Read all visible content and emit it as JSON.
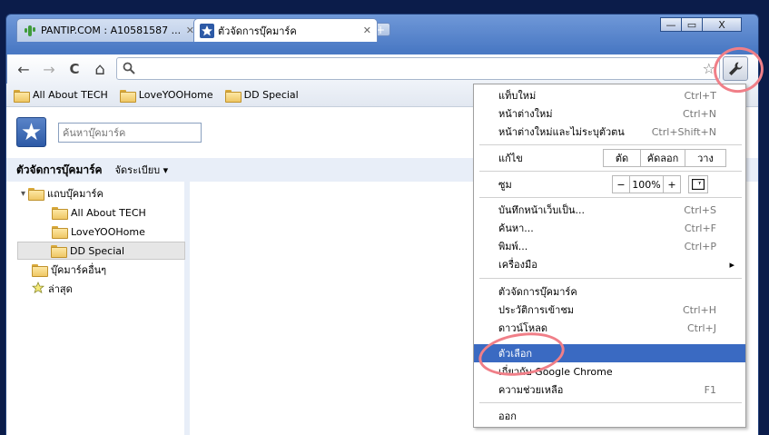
{
  "window": {
    "controls": {
      "minimize": "—",
      "maximize": "▭",
      "close": "X"
    }
  },
  "tabs": [
    {
      "title": "PANTIP.COM : A10581587 ...",
      "close": "✕"
    },
    {
      "title": "ตัวจัดการบุ๊คมาร์ค",
      "close": "✕"
    }
  ],
  "new_tab": "+",
  "toolbar": {
    "back": "←",
    "forward": "→",
    "reload": "C",
    "home": "⌂",
    "omnibox_value": "",
    "star": "☆"
  },
  "bookmarks_bar": [
    "All About TECH",
    "LoveYOOHome",
    "DD Special"
  ],
  "bookmark_manager": {
    "search_placeholder": "ค้นหาบุ๊คมาร์ค",
    "title": "ตัวจัดการบุ๊คมาร์ค",
    "organize": "จัดระเบียบ ▾",
    "tree": [
      {
        "label": "แถบบุ๊คมาร์ค",
        "expander": "▾"
      },
      {
        "label": "All About TECH"
      },
      {
        "label": "LoveYOOHome"
      },
      {
        "label": "DD Special"
      },
      {
        "label": "บุ๊คมาร์คอื่นๆ"
      },
      {
        "label": "ล่าสุด"
      }
    ]
  },
  "menu": {
    "new_tab": {
      "label": "แท็บใหม่",
      "shortcut": "Ctrl+T"
    },
    "new_window": {
      "label": "หน้าต่างใหม่",
      "shortcut": "Ctrl+N"
    },
    "incognito": {
      "label": "หน้าต่างใหม่และไม่ระบุตัวตน",
      "shortcut": "Ctrl+Shift+N"
    },
    "edit": {
      "label": "แก้ไข",
      "cut": "ตัด",
      "copy": "คัดลอก",
      "paste": "วาง"
    },
    "zoom": {
      "label": "ซูม",
      "minus": "−",
      "value": "100%",
      "plus": "+"
    },
    "save_page": {
      "label": "บันทึกหน้าเว็บเป็น...",
      "shortcut": "Ctrl+S"
    },
    "find": {
      "label": "ค้นหา...",
      "shortcut": "Ctrl+F"
    },
    "print": {
      "label": "พิมพ์...",
      "shortcut": "Ctrl+P"
    },
    "tools": {
      "label": "เครื่องมือ",
      "arrow": "▸"
    },
    "bookmark_manager": {
      "label": "ตัวจัดการบุ๊คมาร์ค"
    },
    "history": {
      "label": "ประวัติการเข้าชม",
      "shortcut": "Ctrl+H"
    },
    "downloads": {
      "label": "ดาวน์โหลด",
      "shortcut": "Ctrl+J"
    },
    "options": {
      "label": "ตัวเลือก"
    },
    "about": {
      "label": "เกี่ยวกับ Google Chrome"
    },
    "help": {
      "label": "ความช่วยเหลือ",
      "shortcut": "F1"
    },
    "exit": {
      "label": "ออก"
    }
  },
  "colors": {
    "highlight": "#3a6ac2",
    "annotation": "#f07f88",
    "frame": "#4a7cc7"
  }
}
